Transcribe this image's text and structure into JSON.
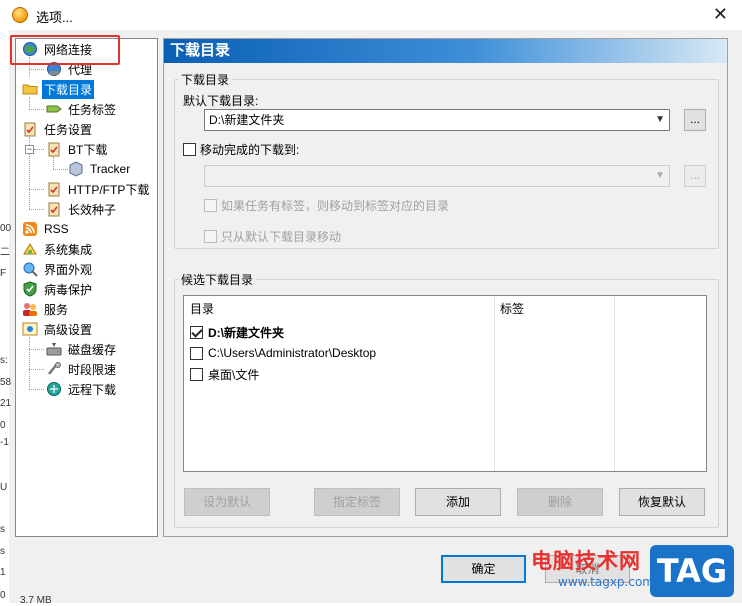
{
  "window": {
    "title": "选项..."
  },
  "background_fragments": [
    "00",
    "二",
    "F",
    "s:",
    "58",
    "21",
    "0",
    "-1",
    "U",
    "s",
    "s",
    "1",
    "0",
    "3.7 MB",
    "0"
  ],
  "tree": {
    "items": [
      {
        "label": "网络连接",
        "icon": "globe-network-icon"
      },
      {
        "label": "代理",
        "icon": "globe-proxy-icon"
      },
      {
        "label": "下载目录",
        "icon": "folder-icon"
      },
      {
        "label": "任务标签",
        "icon": "tag-icon"
      },
      {
        "label": "任务设置",
        "icon": "clipboard-icon"
      },
      {
        "label": "BT下载",
        "icon": "clipboard-icon"
      },
      {
        "label": "Tracker",
        "icon": "cube-icon"
      },
      {
        "label": "HTTP/FTP下载",
        "icon": "clipboard-icon"
      },
      {
        "label": "长效种子",
        "icon": "clipboard-icon"
      },
      {
        "label": "RSS",
        "icon": "rss-icon"
      },
      {
        "label": "系统集成",
        "icon": "integration-icon"
      },
      {
        "label": "界面外观",
        "icon": "appearance-icon"
      },
      {
        "label": "病毒保护",
        "icon": "shield-icon"
      },
      {
        "label": "服务",
        "icon": "users-icon"
      },
      {
        "label": "高级设置",
        "icon": "advanced-icon"
      },
      {
        "label": "磁盘缓存",
        "icon": "disk-icon"
      },
      {
        "label": "时段限速",
        "icon": "speed-icon"
      },
      {
        "label": "远程下载",
        "icon": "remote-icon"
      }
    ]
  },
  "panel": {
    "header": "下载目录",
    "download_group": {
      "title": "下载目录",
      "default_label": "默认下载目录:",
      "default_value": "D:\\新建文件夹",
      "browse_label": "...",
      "move_label": "移动完成的下载到:",
      "move_value": "",
      "move_browse_label": "...",
      "tag_option": "如果任务有标签，则移动到标签对应的目录",
      "only_default_option": "只从默认下载目录移动"
    },
    "candidate_group": {
      "title": "候选下载目录",
      "columns": [
        "目录",
        "标签"
      ],
      "rows": [
        {
          "path": "D:\\新建文件夹",
          "checked": true
        },
        {
          "path": "C:\\Users\\Administrator\\Desktop",
          "checked": false
        },
        {
          "path": "桌面\\文件",
          "checked": false
        }
      ],
      "buttons": {
        "set_default": "设为默认",
        "assign_tag": "指定标签",
        "add": "添加",
        "delete": "删除",
        "restore": "恢复默认"
      }
    }
  },
  "footer": {
    "ok": "确定",
    "cancel": "取消"
  },
  "watermark": {
    "text": "电脑技术网",
    "url": "www.tagxp.com",
    "logo": "TAG"
  },
  "colors": {
    "selection": "#0078d7",
    "header_start": "#0a5fb4",
    "highlight_box": "#e0322f"
  }
}
